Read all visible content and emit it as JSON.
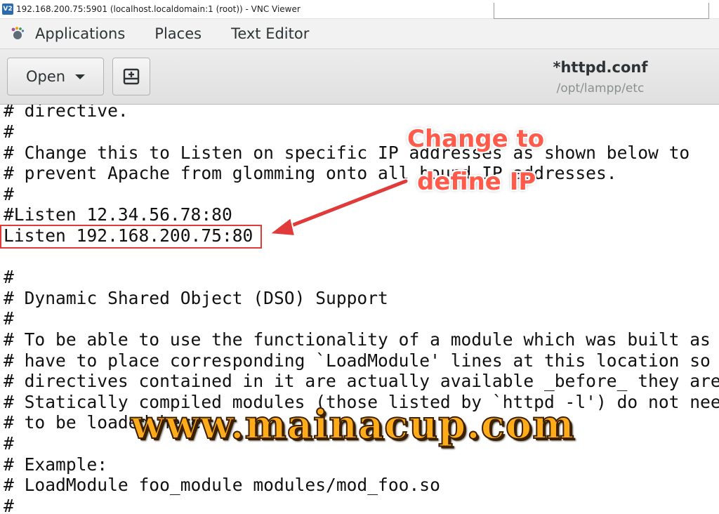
{
  "window": {
    "app_icon_label": "V2",
    "title": "192.168.200.75:5901 (localhost.localdomain:1 (root)) - VNC Viewer"
  },
  "panel": {
    "applications": "Applications",
    "places": "Places",
    "text_editor": "Text Editor"
  },
  "header": {
    "open_label": "Open",
    "doc_title": "*httpd.conf",
    "doc_path": "/opt/lampp/etc"
  },
  "editor": {
    "lines": [
      "# directive.",
      "#",
      "# Change this to Listen on specific IP addresses as shown below to",
      "# prevent Apache from glomming onto all bound IP addresses.",
      "#",
      "#Listen 12.34.56.78:80",
      "Listen 192.168.200.75:80",
      "",
      "#",
      "# Dynamic Shared Object (DSO) Support",
      "#",
      "# To be able to use the functionality of a module which was built as",
      "# have to place corresponding `LoadModule' lines at this location so",
      "# directives contained in it are actually available _before_ they are",
      "# Statically compiled modules (those listed by `httpd -l') do not nee",
      "# to be loaded here.",
      "#",
      "# Example:",
      "# LoadModule foo_module modules/mod_foo.so",
      "#"
    ]
  },
  "annotation": {
    "callout_line1": "Change to",
    "callout_line2": "define IP",
    "watermark": "www.mainacup.com",
    "accent_color": "#e03a3a"
  }
}
